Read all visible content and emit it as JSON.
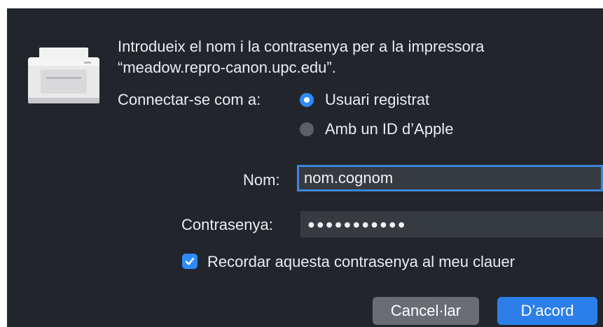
{
  "dialog": {
    "icon": "printer-icon",
    "message_line1": "Introdueix el nom i la contrasenya per a la impressora",
    "message_line2": "“meadow.repro-canon.upc.edu”.",
    "connect_label": "Connectar-se com a:",
    "options": [
      {
        "label": "Usuari registrat",
        "selected": true
      },
      {
        "label": "Amb un ID d’Apple",
        "selected": false
      }
    ],
    "name_label": "Nom:",
    "name_value": "nom.cognom",
    "password_label": "Contrasenya:",
    "password_value": "●●●●●●●●●●●",
    "remember_label": "Recordar aquesta contrasenya al meu clauer",
    "remember_checked": true,
    "cancel_label": "Cancel·lar",
    "ok_label": "D’acord"
  },
  "colors": {
    "background": "#22262c",
    "accent": "#2e8bff",
    "field_bg": "#363a41",
    "cancel_bg": "#6a6d73"
  }
}
